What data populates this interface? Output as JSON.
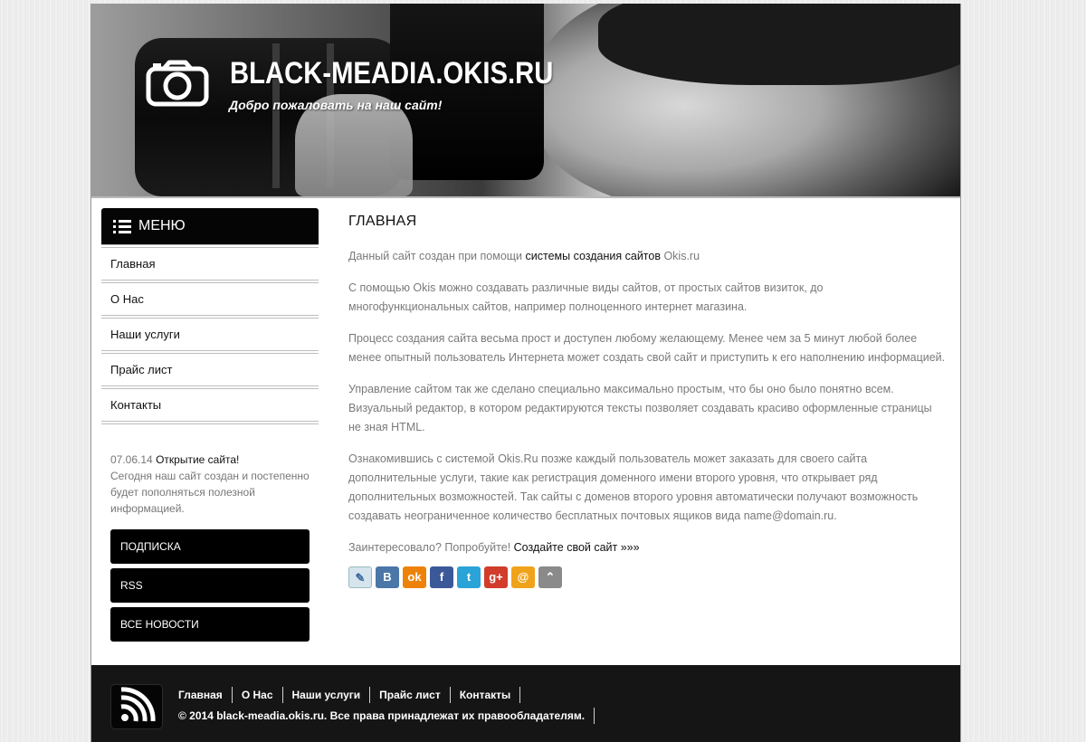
{
  "header": {
    "site_title": "BLACK-MEADIA.OKIS.RU",
    "subtitle": "Добро пожаловать на наш сайт!",
    "logo_icon": "camera-icon"
  },
  "sidebar": {
    "menu_title": "МЕНЮ",
    "menu_icon": "list-icon",
    "items": [
      {
        "label": "Главная"
      },
      {
        "label": "О Нас"
      },
      {
        "label": "Наши услуги"
      },
      {
        "label": "Прайс лист"
      },
      {
        "label": "Контакты"
      }
    ],
    "news": {
      "date": "07.06.14",
      "title": "Открытие сайта!",
      "text": "Сегодня наш сайт создан и постепенно будет пополняться полезной информацией."
    },
    "buttons": [
      {
        "label": "ПОДПИСКА"
      },
      {
        "label": "RSS"
      },
      {
        "label": "ВСЕ НОВОСТИ"
      }
    ]
  },
  "main": {
    "title": "ГЛАВНАЯ",
    "p1_prefix": "Данный сайт создан при помощи ",
    "p1_link": "системы создания сайтов",
    "p1_suffix": " Okis.ru",
    "p2": "С помощью Okis можно создавать различные виды сайтов, от простых сайтов визиток, до многофункциональных сайтов, например полноценного интернет магазина.",
    "p3": "Процесс создания сайта весьма прост и доступен любому желающему. Менее чем за 5 минут любой более менее опытный пользователь Интернета может создать свой сайт и приступить к его наполнению информацией.",
    "p4": "Управление сайтом так же сделано специально максимально простым, что бы оно было понятно всем. Визуальный редактор, в котором редактируются тексты позволяет создавать красиво оформленные страницы не зная HTML.",
    "p5": "Ознакомившись с системой Okis.Ru позже каждый пользователь может заказать для своего сайта дополнительные услуги, такие как регистрация доменного имени второго уровня, что открывает ряд дополнительных возможностей. Так сайты с доменов второго уровня автоматически получают возможность создавать неограниченное количество бесплатных почтовых ящиков вида name@domain.ru.",
    "p6_prefix": "Заинтересовало? Попробуйте! ",
    "p6_link": "Создайте свой сайт »»»",
    "social": [
      {
        "name": "livejournal-icon",
        "glyph": "✎",
        "color": "#d6e4ee"
      },
      {
        "name": "vkontakte-icon",
        "glyph": "B",
        "color": "#4a76a8"
      },
      {
        "name": "odnoklassniki-icon",
        "glyph": "ok",
        "color": "#ee8208"
      },
      {
        "name": "facebook-icon",
        "glyph": "f",
        "color": "#3b5998"
      },
      {
        "name": "twitter-icon",
        "glyph": "t",
        "color": "#2aa3d8"
      },
      {
        "name": "google-plus-icon",
        "glyph": "g+",
        "color": "#d23c2a"
      },
      {
        "name": "mail-ru-icon",
        "glyph": "@",
        "color": "#f0a31a"
      },
      {
        "name": "more-icon",
        "glyph": "⌃",
        "color": "#8a8a8a"
      }
    ]
  },
  "footer": {
    "rss_icon": "rss-icon",
    "links": [
      {
        "label": "Главная"
      },
      {
        "label": "О Нас"
      },
      {
        "label": "Наши услуги"
      },
      {
        "label": "Прайс лист"
      },
      {
        "label": "Контакты"
      }
    ],
    "copyright": "© 2014 black-meadia.okis.ru. Все права принадлежат их правообладателям."
  }
}
